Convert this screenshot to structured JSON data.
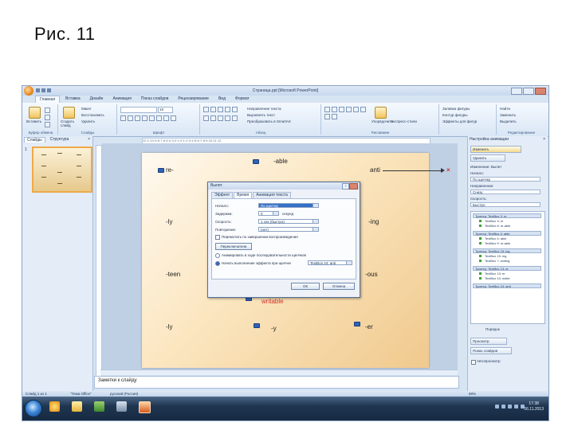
{
  "slide_title": "Рис. 11",
  "window": {
    "title": "Страница.ppt [Microsoft PowerPoint]",
    "tabs": [
      "Главная",
      "Вставка",
      "Дизайн",
      "Анимация",
      "Показ слайдов",
      "Рецензирование",
      "Вид",
      "Формат"
    ],
    "active_tab": "Главная"
  },
  "ribbon": {
    "paste": "Вставить",
    "new_slide": "Создать слайд",
    "clipboard_group": "Буфер обмена",
    "slides_group": "Слайды",
    "layout": "Макет",
    "reset": "Восстановить",
    "delete": "Удалить",
    "font_group": "Шрифт",
    "font_size": "18",
    "paragraph_group": "Абзац",
    "text_direction": "Направление текста",
    "align_text": "Выровнять текст",
    "smartart": "Преобразовать в SmartArt",
    "drawing_group": "Рисование",
    "arrange": "Упорядочить",
    "quick_styles": "Экспресс-стили",
    "shape_fill": "Заливка фигуры",
    "shape_outline": "Контур фигуры",
    "shape_effects": "Эффекты для фигур",
    "find": "Найти",
    "replace": "Заменить",
    "select": "Выделить",
    "editing_group": "Редактирование"
  },
  "left_pane": {
    "tab_slides": "Слайды",
    "tab_outline": "Структура",
    "close": "×",
    "slide_number": "1"
  },
  "ruler_text": "12·1·10·9·8·7·6·5·4·3·2·1·0·1·2·3·4·5·6·7·8·9·10·11·12",
  "slide": {
    "words": [
      "-able",
      "re-",
      "anti",
      "-ly",
      "-ing",
      "-teen",
      "-ous",
      "writable",
      "-ly",
      "-y",
      "-er"
    ]
  },
  "dialog": {
    "title": "Вылет",
    "help": "?",
    "tabs": [
      "Эффект",
      "Время",
      "Анимация текста"
    ],
    "active_tab": "Время",
    "labels": {
      "start": "Начало:",
      "delay": "Задержка:",
      "speed": "Скорость:",
      "repeat": "Повторение:",
      "rewind": "Перемотать по завершении воспроизведения",
      "triggers": "Переключатели",
      "animate_seq": "Анимировать в ходе последовательности щелчков",
      "start_on_click": "Начать выполнение эффекта при щелчке"
    },
    "values": {
      "start": "По щелчку",
      "delay": "0",
      "delay_unit": "секунд",
      "speed": "1 сек (быстро)",
      "repeat": "(нет)",
      "click_object": "TextBox 24: anti"
    },
    "ok": "ОК",
    "cancel": "Отмена"
  },
  "notes": "Заметки к слайду",
  "task_pane": {
    "title": "Настройка анимации",
    "change": "Изменить",
    "remove": "Удалить",
    "modify_label": "Изменение: Вылет",
    "start_label": "Начало:",
    "start_value": "По щелчку",
    "direction_label": "Направление:",
    "direction_value": "Снизу",
    "speed_label": "Скорость:",
    "speed_value": "Быстро",
    "list": [
      {
        "head": "Триггер: TextBox 3: re",
        "items": [
          "TextBox 3: re",
          "TextBox 8: re-able"
        ]
      },
      {
        "head": "Триггер: TextBox 4: able",
        "items": [
          "TextBox 4: able",
          "TextBox 9: re-able"
        ]
      },
      {
        "head": "Триггер: TextBox 15: ing",
        "items": [
          "TextBox 15: ing",
          "TextBox 7: writing"
        ]
      },
      {
        "head": "Триггер: TextBox 13: er",
        "items": [
          "TextBox 13: er",
          "TextBox 10: writer"
        ]
      },
      {
        "head": "Триггер: TextBox 24: anti",
        "items": []
      }
    ],
    "reorder": "Порядок",
    "play": "Просмотр",
    "slideshow": "Показ слайдов",
    "autopreview": "Автопросмотр"
  },
  "status": {
    "slide": "Слайд 1 из 1",
    "theme": "\"Тема Office\"",
    "lang": "русский (Россия)",
    "zoom": "68%"
  },
  "clock": {
    "time": "17:38",
    "date": "06.11.2013"
  }
}
